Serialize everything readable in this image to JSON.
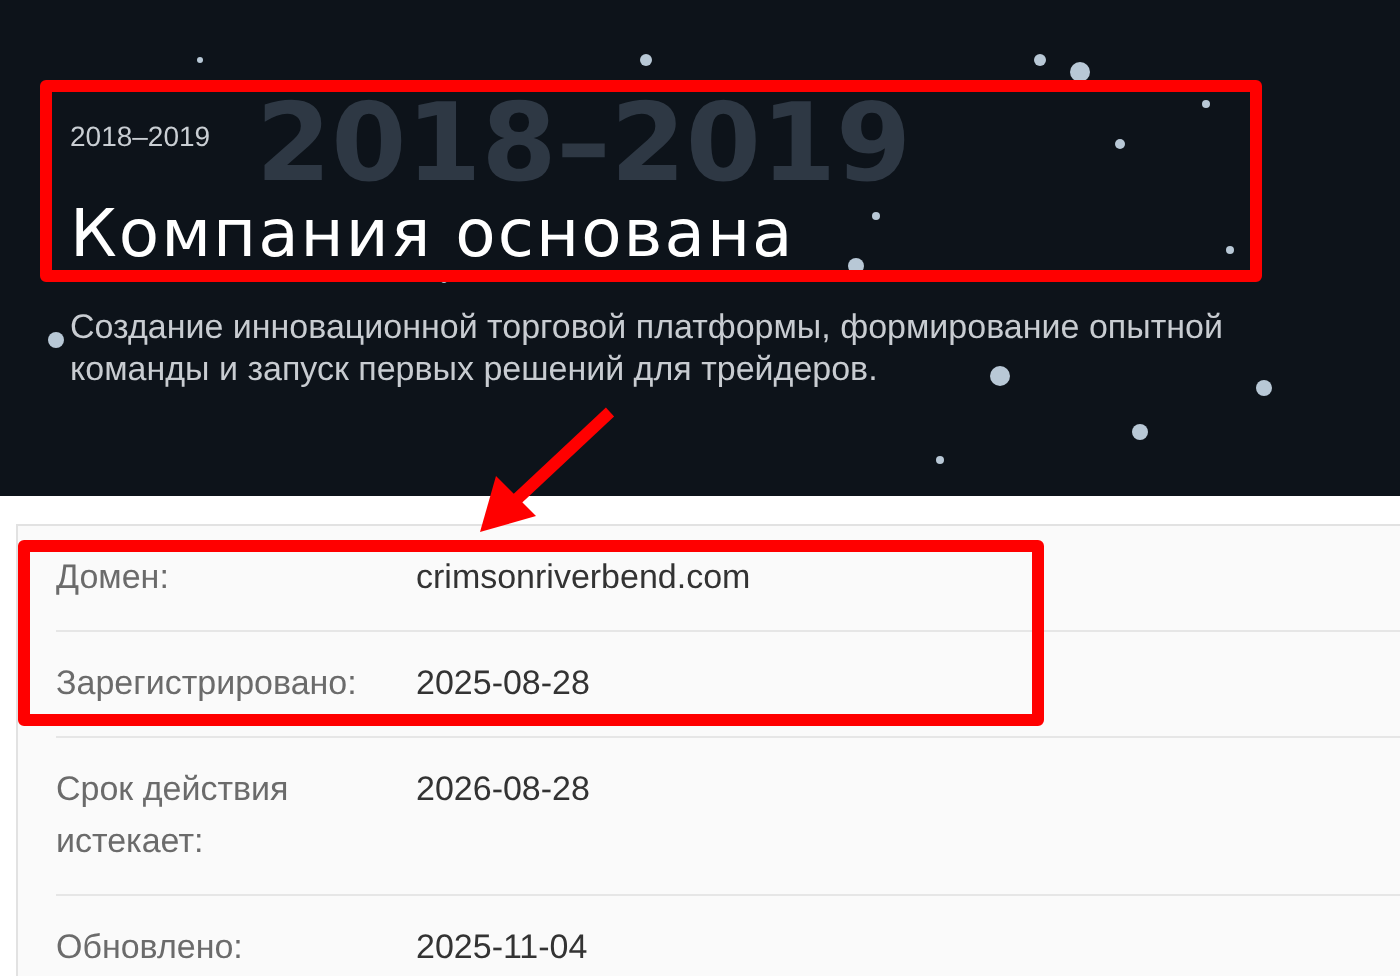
{
  "hero": {
    "backdrop_text": "2018–2019",
    "period": "2018–2019",
    "title": "Компания основана",
    "description": "Создание инновационной торговой платформы, формирование опытной команды и запуск первых решений для трейдеров."
  },
  "domain_info": {
    "rows": [
      {
        "label": "Домен:",
        "value": "crimsonriverbend.com"
      },
      {
        "label": "Зарегистрировано:",
        "value": "2025-08-28"
      },
      {
        "label": "Срок действия истекает:",
        "value": "2026-08-28"
      },
      {
        "label": "Обновлено:",
        "value": "2025-11-04"
      }
    ]
  }
}
